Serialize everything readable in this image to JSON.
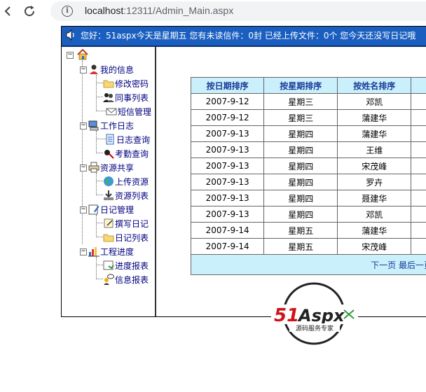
{
  "browser": {
    "url_host": "localhost",
    "url_rest": ":12311/Admin_Main.aspx"
  },
  "topbar": {
    "text": "您好：51aspx今天是星期五   您有未读信件：0封     已经上传文件：0个     您今天还没写日记哦"
  },
  "tree": {
    "groups": [
      {
        "label": "我的信息",
        "children": [
          "修改密码",
          "同事列表",
          "短信管理"
        ]
      },
      {
        "label": "工作日志",
        "children": [
          "日志查询",
          "考勤查询"
        ]
      },
      {
        "label": "资源共享",
        "children": [
          "上传资源",
          "资源列表"
        ]
      },
      {
        "label": "日记管理",
        "children": [
          "撰写日记",
          "日记列表"
        ]
      },
      {
        "label": "工程进度",
        "children": [
          "进度报表",
          "信息报表"
        ]
      }
    ]
  },
  "table": {
    "headers": [
      "按日期排序",
      "按星期排序",
      "按姓名排序",
      ""
    ],
    "rows": [
      [
        "2007-9-12",
        "星期三",
        "邓凯",
        ""
      ],
      [
        "2007-9-12",
        "星期三",
        "蒲建华",
        ""
      ],
      [
        "2007-9-13",
        "星期四",
        "蒲建华",
        ""
      ],
      [
        "2007-9-13",
        "星期四",
        "王维",
        ""
      ],
      [
        "2007-9-13",
        "星期四",
        "宋茂峰",
        ""
      ],
      [
        "2007-9-13",
        "星期四",
        "罗卉",
        ""
      ],
      [
        "2007-9-13",
        "星期四",
        "聂建华",
        ""
      ],
      [
        "2007-9-13",
        "星期四",
        "邓凯",
        ""
      ],
      [
        "2007-9-14",
        "星期五",
        "蒲建华",
        ""
      ],
      [
        "2007-9-14",
        "星期五",
        "宋茂峰",
        ""
      ]
    ],
    "pager": {
      "next": "下一页",
      "last": "最后一页"
    }
  },
  "logo": {
    "main": "51Aspx",
    "sub": "源码服务专家"
  },
  "colors": {
    "topbar_bg": "#1a5fc0",
    "header_bg": "#c9f0fb",
    "link": "#1a3a9a",
    "tree_text": "#000080",
    "logo_red": "#d0121b",
    "logo_green": "#2e9a3a"
  }
}
